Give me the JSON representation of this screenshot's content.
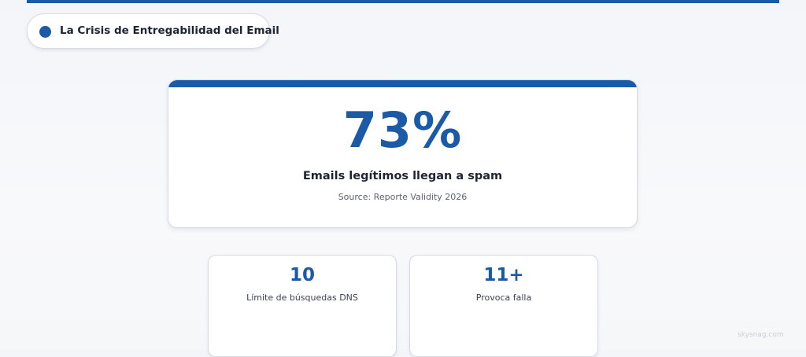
{
  "header": {
    "badge_text": "La Crisis de Entregabilidad del Email",
    "accent_color": "#1b5aa6"
  },
  "hero": {
    "value": "73%",
    "label": "Emails legítimos llegan a spam",
    "source": "Source: Reporte Validity 2026"
  },
  "stats": [
    {
      "value": "10",
      "label": "Límite de búsquedas DNS"
    },
    {
      "value": "11+",
      "label": "Provoca falla"
    }
  ],
  "watermark": "skysnag.com"
}
